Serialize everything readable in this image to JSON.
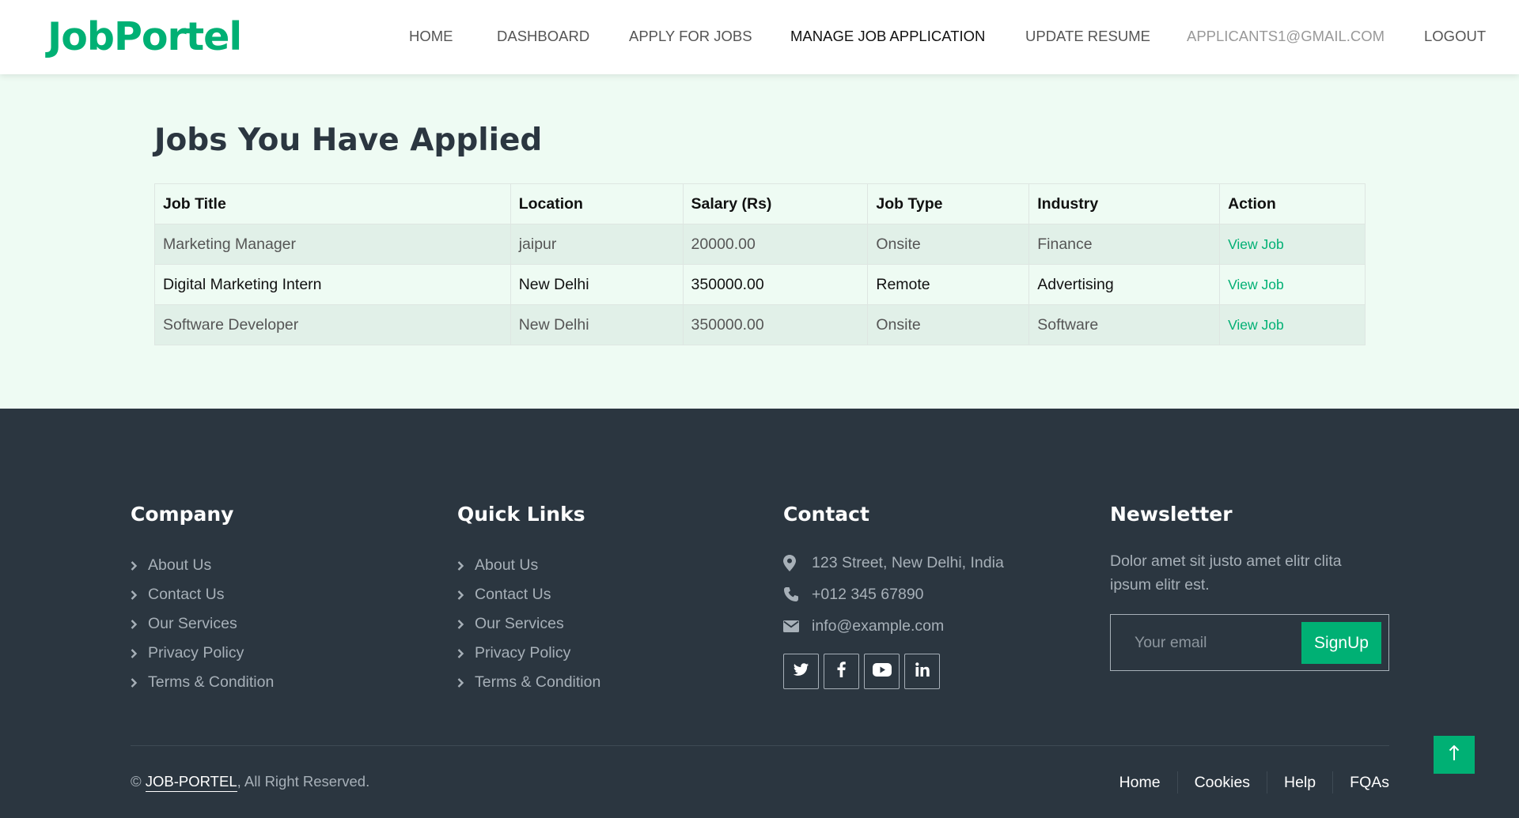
{
  "brand": "JobPortel",
  "nav": {
    "home": "HOME",
    "dashboard": "DASHBOARD",
    "apply": "APPLY FOR JOBS",
    "manage": "MANAGE JOB APPLICATION",
    "resume": "UPDATE RESUME",
    "email": "APPLICANTS1@GMAIL.COM",
    "logout": "LOGOUT"
  },
  "main": {
    "title": "Jobs You Have Applied",
    "columns": [
      "Job Title",
      "Location",
      "Salary (Rs)",
      "Job Type",
      "Industry",
      "Action"
    ],
    "rows": [
      [
        "Marketing Manager",
        "jaipur",
        "20000.00",
        "Onsite",
        "Finance",
        "View Job"
      ],
      [
        "Digital Marketing Intern",
        "New Delhi",
        "350000.00",
        "Remote",
        "Advertising",
        "View Job"
      ],
      [
        "Software Developer",
        "New Delhi",
        "350000.00",
        "Onsite",
        "Software",
        "View Job"
      ]
    ]
  },
  "footer": {
    "company": {
      "heading": "Company",
      "links": [
        "About Us",
        "Contact Us",
        "Our Services",
        "Privacy Policy",
        "Terms & Condition"
      ]
    },
    "quick": {
      "heading": "Quick Links",
      "links": [
        "About Us",
        "Contact Us",
        "Our Services",
        "Privacy Policy",
        "Terms & Condition"
      ]
    },
    "contact": {
      "heading": "Contact",
      "address": "123 Street, New Delhi, India",
      "phone": "+012 345 67890",
      "email": "info@example.com"
    },
    "newsletter": {
      "heading": "Newsletter",
      "text": "Dolor amet sit justo amet elitr clita ipsum elitr est.",
      "placeholder": "Your email",
      "button": "SignUp"
    },
    "copyright": {
      "symbol": "©",
      "brand": "JOB-PORTEL",
      "rest": ", All Right Reserved."
    },
    "bottom_links": [
      "Home",
      "Cookies",
      "Help",
      "FQAs"
    ]
  },
  "icons": {
    "social": [
      "twitter-icon",
      "facebook-icon",
      "youtube-icon",
      "linkedin-icon"
    ],
    "to_top": "arrow-up-icon"
  },
  "colors": {
    "accent": "#00B074",
    "dark": "#2B3640",
    "light_bg": "#EEFBF3"
  }
}
